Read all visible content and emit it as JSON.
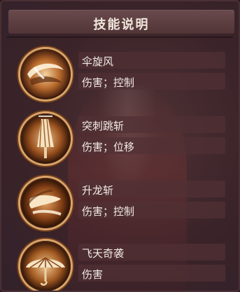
{
  "header": {
    "title": "技能说明"
  },
  "skills": [
    {
      "name": "伞旋风",
      "desc": "伤害；控制",
      "icon": "umbrella-spin-icon"
    },
    {
      "name": "突刺跳斩",
      "desc": "伤害；位移",
      "icon": "umbrella-thrust-icon"
    },
    {
      "name": "升龙斩",
      "desc": "伤害；控制",
      "icon": "rising-slash-icon"
    },
    {
      "name": "飞天奇袭",
      "desc": "伤害",
      "icon": "open-umbrella-icon"
    }
  ],
  "colors": {
    "panel_bg": "#3a2730",
    "header_bg": "#5e4043",
    "icon_ring": "#d9a46a",
    "text": "#f2ebe6"
  }
}
